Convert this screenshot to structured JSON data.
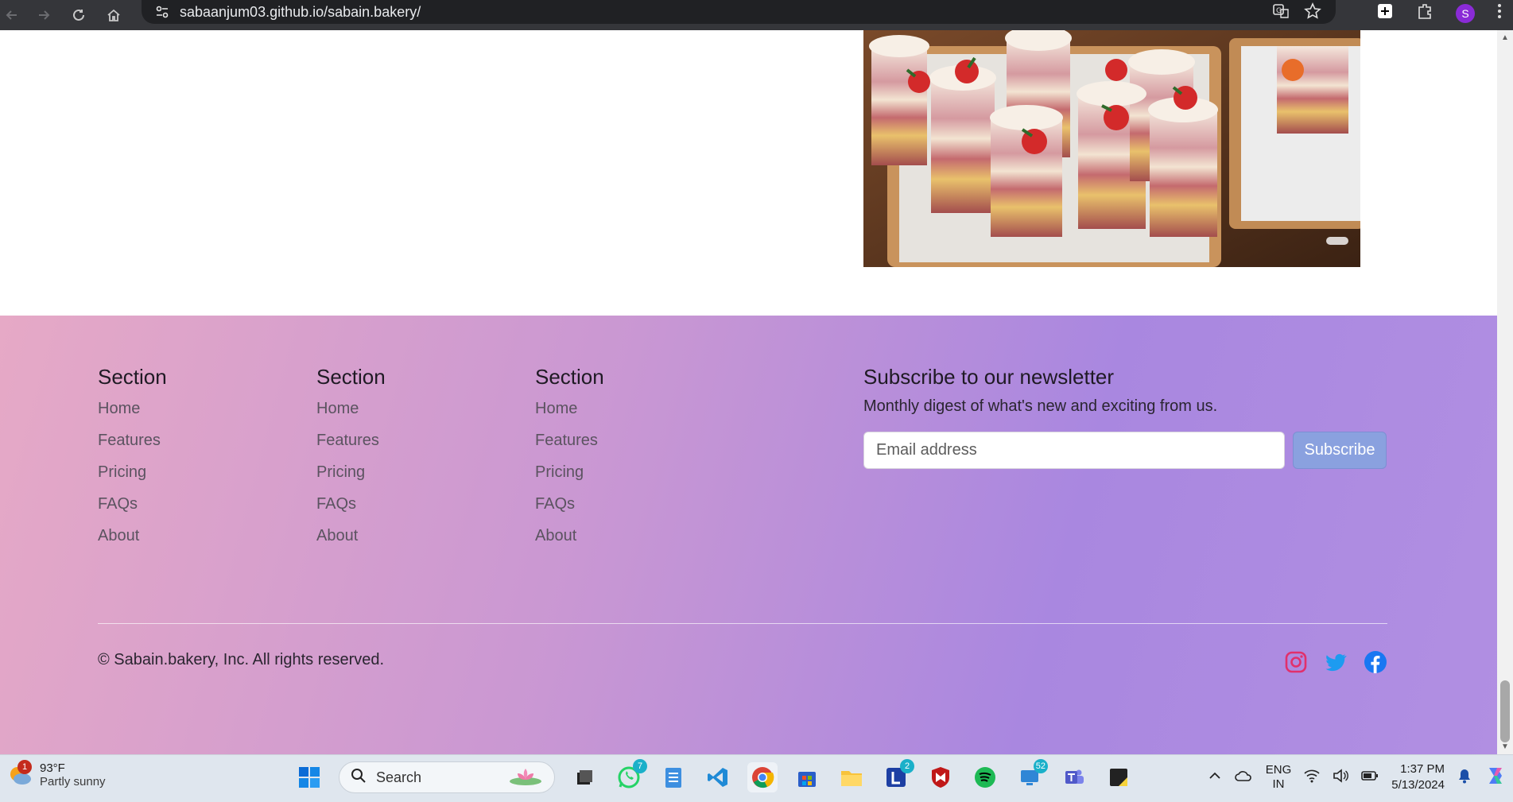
{
  "browser": {
    "url": "sabaanjum03.github.io/sabain.bakery/",
    "profile_initial": "S"
  },
  "footer": {
    "columns": [
      {
        "heading": "Section",
        "links": [
          "Home",
          "Features",
          "Pricing",
          "FAQs",
          "About"
        ]
      },
      {
        "heading": "Section",
        "links": [
          "Home",
          "Features",
          "Pricing",
          "FAQs",
          "About"
        ]
      },
      {
        "heading": "Section",
        "links": [
          "Home",
          "Features",
          "Pricing",
          "FAQs",
          "About"
        ]
      }
    ],
    "newsletter": {
      "heading": "Subscribe to our newsletter",
      "description": "Monthly digest of what's new and exciting from us.",
      "email_placeholder": "Email address",
      "button_label": "Subscribe"
    },
    "copyright": "© Sabain.bakery, Inc. All rights reserved.",
    "social": [
      "instagram-icon",
      "twitter-icon",
      "facebook-icon"
    ]
  },
  "colors": {
    "instagram": "#e1306c",
    "twitter": "#1d9bf0",
    "facebook": "#1877f2",
    "subscribe_button": "#8aa1df"
  },
  "taskbar": {
    "weather_badge": "1",
    "temperature": "93°F",
    "condition": "Partly sunny",
    "search_label": "Search",
    "whatsapp_badge": "7",
    "l_app_badge": "2",
    "store_badge": "52",
    "language_line1": "ENG",
    "language_line2": "IN",
    "time": "1:37 PM",
    "date": "5/13/2024"
  }
}
